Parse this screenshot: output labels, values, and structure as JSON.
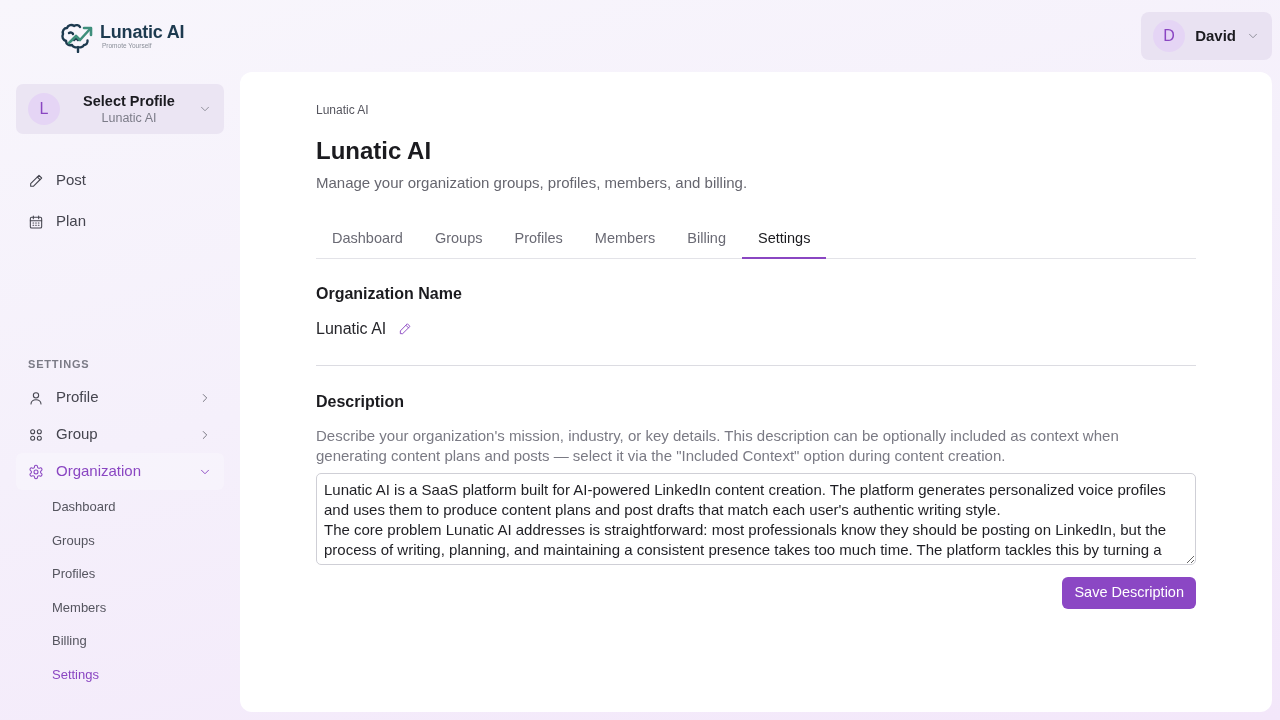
{
  "sidebar": {
    "logo": {
      "name": "Lunatic AI",
      "tagline": "Promote Yourself"
    },
    "profile_selector": {
      "avatar_letter": "L",
      "title": "Select Profile",
      "subtitle": "Lunatic AI"
    },
    "nav_items": [
      {
        "label": "Post",
        "selected": false
      },
      {
        "label": "Plan",
        "selected": false
      }
    ],
    "settings_section": {
      "heading": "SETTINGS",
      "items": [
        {
          "label": "Profile",
          "selected": false,
          "expanded": false
        },
        {
          "label": "Group",
          "selected": false,
          "expanded": false
        },
        {
          "label": "Organization",
          "selected": true,
          "expanded": true,
          "children": [
            {
              "label": "Dashboard",
              "selected": false
            },
            {
              "label": "Groups",
              "selected": false
            },
            {
              "label": "Profiles",
              "selected": false
            },
            {
              "label": "Members",
              "selected": false
            },
            {
              "label": "Billing",
              "selected": false
            },
            {
              "label": "Settings",
              "selected": true
            }
          ]
        }
      ]
    }
  },
  "user_menu": {
    "avatar_letter": "D",
    "name": "David"
  },
  "breadcrumb": [
    "Lunatic AI"
  ],
  "page": {
    "title": "Lunatic AI",
    "subtitle": "Manage your organization groups, profiles, members, and billing."
  },
  "tabs": [
    {
      "label": "Dashboard",
      "selected": false
    },
    {
      "label": "Groups",
      "selected": false
    },
    {
      "label": "Profiles",
      "selected": false
    },
    {
      "label": "Members",
      "selected": false
    },
    {
      "label": "Billing",
      "selected": false
    },
    {
      "label": "Settings",
      "selected": true
    }
  ],
  "organization_name": {
    "heading": "Organization Name",
    "value": "Lunatic AI"
  },
  "description": {
    "heading": "Description",
    "help_text": "Describe your organization's mission, industry, or key details. This description can be optionally included as context when generating content plans and posts — select it via the \"Included Context\" option during content creation.",
    "value": "Lunatic AI is a SaaS platform built for AI-powered LinkedIn content creation. The platform generates personalized voice profiles and uses them to produce content plans and post drafts that match each user's authentic writing style.\nThe core problem Lunatic AI addresses is straightforward: most professionals know they should be posting on LinkedIn, but the process of writing, planning, and maintaining a consistent presence takes too much time. The platform tackles this by turning a"
  },
  "save_button": "Save Description"
}
